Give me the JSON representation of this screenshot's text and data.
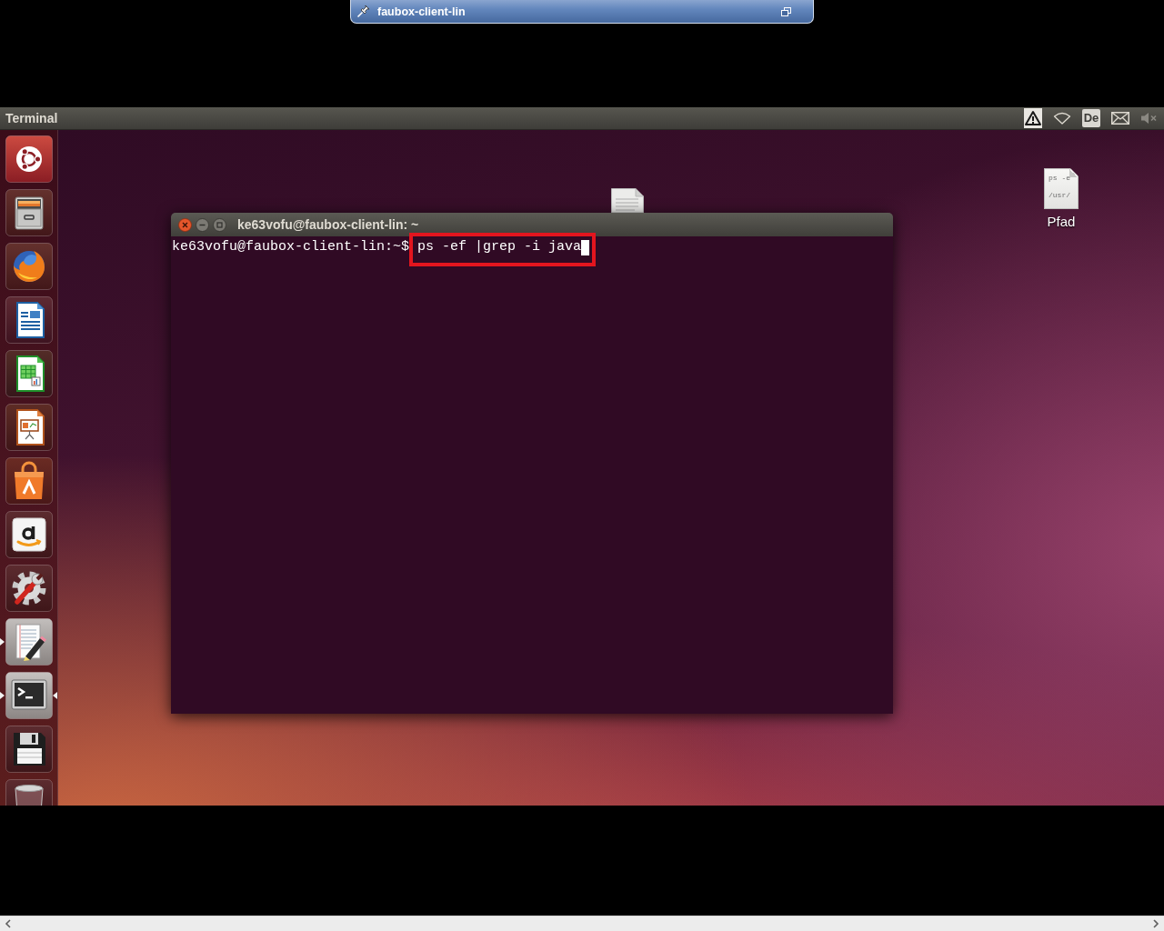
{
  "remote_bar": {
    "title": "faubox-client-lin"
  },
  "panel": {
    "app_title": "Terminal",
    "indicators": [
      {
        "kind": "warning"
      },
      {
        "kind": "network"
      },
      {
        "kind": "keyboard",
        "label": "De"
      },
      {
        "kind": "mail"
      },
      {
        "kind": "volume_muted"
      }
    ]
  },
  "launcher": {
    "items": [
      {
        "kind": "dash",
        "running": false,
        "focused": false
      },
      {
        "kind": "files",
        "running": false,
        "focused": false
      },
      {
        "kind": "browser",
        "running": false,
        "focused": false
      },
      {
        "kind": "document",
        "running": false,
        "focused": false
      },
      {
        "kind": "spreadsheet",
        "running": false,
        "focused": false
      },
      {
        "kind": "presentation",
        "running": false,
        "focused": false
      },
      {
        "kind": "store",
        "running": false,
        "focused": false
      },
      {
        "kind": "shopping",
        "running": false,
        "focused": false
      },
      {
        "kind": "settings",
        "running": false,
        "focused": false
      },
      {
        "kind": "text_editor",
        "running": true,
        "focused": false
      },
      {
        "kind": "terminal",
        "running": true,
        "focused": true
      },
      {
        "kind": "save",
        "running": false,
        "focused": false
      },
      {
        "kind": "trash",
        "running": false,
        "focused": false
      }
    ]
  },
  "desktop": {
    "icons": [
      {
        "label": "Pfad",
        "preview": [
          "ps -e",
          "/usr/"
        ]
      }
    ]
  },
  "terminal": {
    "title": "ke63vofu@faubox-client-lin: ~",
    "lines": [
      {
        "prompt": "ke63vofu@faubox-client-lin:~$",
        "command": "ps -ef |grep -i java",
        "highlighted": true,
        "cursor": true
      }
    ]
  }
}
